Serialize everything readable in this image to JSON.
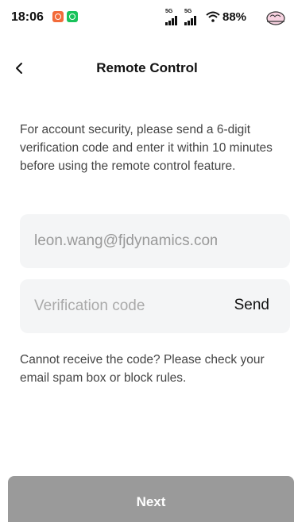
{
  "status_bar": {
    "time": "18:06",
    "network_1": "5G",
    "network_2": "5G",
    "battery": "88%"
  },
  "header": {
    "title": "Remote Control"
  },
  "main": {
    "info": "For account security, please send a 6-digit verification code and enter it within 10 minutes before using the remote control feature.",
    "email_value": "leon.wang@fjdynamics.com",
    "code_placeholder": "Verification code",
    "send_label": "Send",
    "help": "Cannot receive the code? Please check your email spam box or block rules."
  },
  "footer": {
    "next_label": "Next"
  },
  "colors": {
    "field_bg": "#f4f5f6",
    "next_disabled": "#9a9a9a"
  }
}
